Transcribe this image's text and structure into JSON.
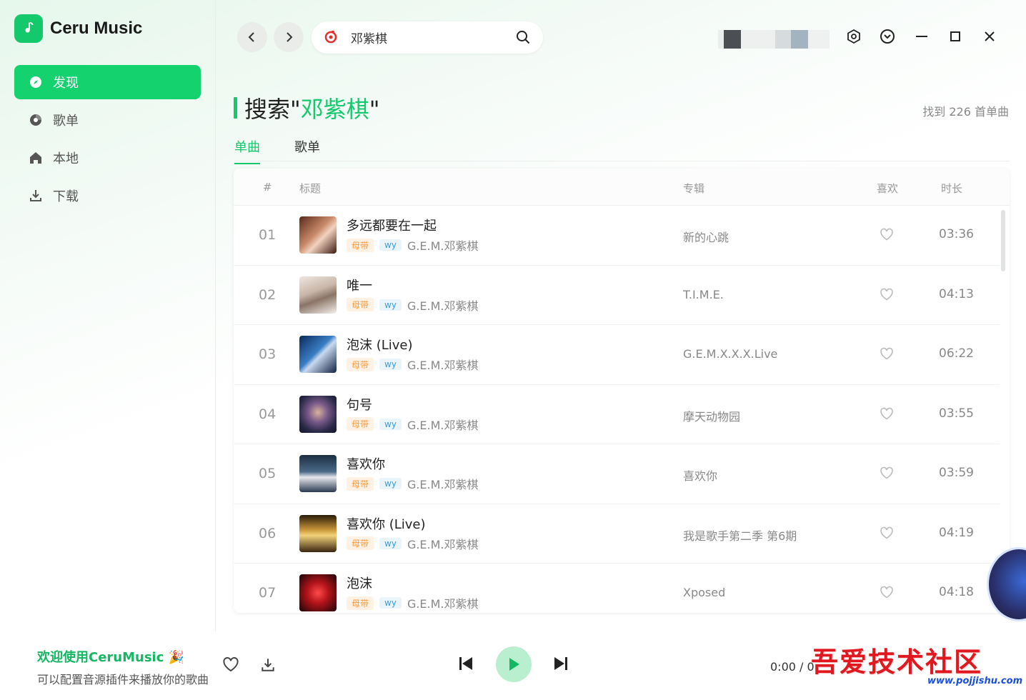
{
  "app": {
    "name": "Ceru Music",
    "accent": "#14c96b"
  },
  "sidebar": {
    "items": [
      {
        "label": "发现",
        "icon": "compass-icon",
        "active": true
      },
      {
        "label": "歌单",
        "icon": "disc-icon",
        "active": false
      },
      {
        "label": "本地",
        "icon": "home-icon",
        "active": false
      },
      {
        "label": "下载",
        "icon": "download-icon",
        "active": false
      }
    ]
  },
  "search": {
    "value": "邓紫棋"
  },
  "heading": {
    "prefix": "搜索\"",
    "keyword": "邓紫棋",
    "suffix": "\""
  },
  "result_count": "找到 226 首单曲",
  "tabs": [
    {
      "label": "单曲",
      "active": true
    },
    {
      "label": "歌单",
      "active": false
    }
  ],
  "table": {
    "columns": {
      "index": "#",
      "title": "标题",
      "album": "专辑",
      "like": "喜欢",
      "duration": "时长"
    },
    "rows": [
      {
        "index": "01",
        "title": "多远都要在一起",
        "quality": "母带",
        "source": "wy",
        "artist": "G.E.M.邓紫棋",
        "album": "新的心跳",
        "duration": "03:36"
      },
      {
        "index": "02",
        "title": "唯一",
        "quality": "母带",
        "source": "wy",
        "artist": "G.E.M.邓紫棋",
        "album": "T.I.M.E.",
        "duration": "04:13"
      },
      {
        "index": "03",
        "title": "泡沫 (Live)",
        "quality": "母带",
        "source": "wy",
        "artist": "G.E.M.邓紫棋",
        "album": "G.E.M.X.X.X.Live",
        "duration": "06:22"
      },
      {
        "index": "04",
        "title": "句号",
        "quality": "母带",
        "source": "wy",
        "artist": "G.E.M.邓紫棋",
        "album": "摩天动物园",
        "duration": "03:55"
      },
      {
        "index": "05",
        "title": "喜欢你",
        "quality": "母带",
        "source": "wy",
        "artist": "G.E.M.邓紫棋",
        "album": "喜欢你",
        "duration": "03:59"
      },
      {
        "index": "06",
        "title": "喜欢你 (Live)",
        "quality": "母带",
        "source": "wy",
        "artist": "G.E.M.邓紫棋",
        "album": "我是歌手第二季 第6期",
        "duration": "04:19"
      },
      {
        "index": "07",
        "title": "泡沫",
        "quality": "母带",
        "source": "wy",
        "artist": "G.E.M.邓紫棋",
        "album": "Xposed",
        "duration": "04:18"
      }
    ]
  },
  "player": {
    "welcome": "欢迎使用CeruMusic 🎉",
    "tip": "可以配置音源插件来播放你的歌曲",
    "time": "0:00 / 0:",
    "watermark": "吾爱技术社区",
    "watermark_url": "www.pojjishu.com"
  }
}
